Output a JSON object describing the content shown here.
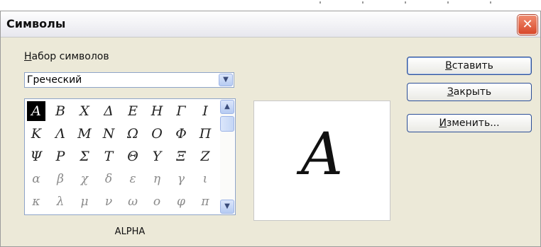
{
  "dialog": {
    "title": "Символы",
    "close_symbol": "✕"
  },
  "charset": {
    "label_accel": "Н",
    "label_rest": "абор символов",
    "selected_value": "Греческий"
  },
  "symbols": {
    "rows": [
      [
        "A",
        "B",
        "X",
        "Δ",
        "E",
        "H",
        "Γ",
        "I"
      ],
      [
        "K",
        "Λ",
        "M",
        "N",
        "Ω",
        "O",
        "Φ",
        "Π"
      ],
      [
        "Ψ",
        "P",
        "Σ",
        "T",
        "Θ",
        "Y",
        "Ξ",
        "Z"
      ],
      [
        "α",
        "β",
        "χ",
        "δ",
        "ε",
        "η",
        "γ",
        "ι"
      ],
      [
        "κ",
        "λ",
        "μ",
        "ν",
        "ω",
        "ο",
        "φ",
        "π"
      ]
    ],
    "selected_index": [
      0,
      0
    ]
  },
  "preview": {
    "character": "A",
    "name": "ALPHA"
  },
  "buttons": {
    "insert": {
      "accel": "В",
      "rest": "ставить"
    },
    "close": {
      "accel": "З",
      "rest": "акрыть"
    },
    "modify": {
      "accel": "И",
      "rest": "зменить..."
    }
  }
}
